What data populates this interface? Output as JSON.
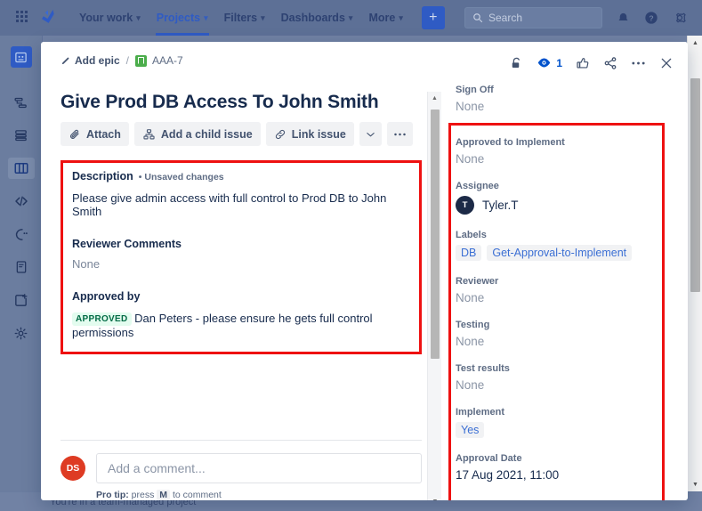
{
  "topnav": {
    "apps_icon": "app-switcher-icon",
    "logo_icon": "jira-logo-icon",
    "items": [
      {
        "label": "Your work",
        "has_chevron": true,
        "active": false
      },
      {
        "label": "Projects",
        "has_chevron": true,
        "active": true
      },
      {
        "label": "Filters",
        "has_chevron": true,
        "active": false
      },
      {
        "label": "Dashboards",
        "has_chevron": true,
        "active": false
      },
      {
        "label": "More",
        "has_chevron": true,
        "active": false
      }
    ],
    "create_label": "+",
    "search_placeholder": "Search",
    "search_value": "",
    "icons": [
      "notifications-icon",
      "help-icon",
      "settings-icon"
    ]
  },
  "leftrail": {
    "items": [
      {
        "name": "project-avatar"
      },
      {
        "name": "roadmap-icon"
      },
      {
        "name": "backlog-icon"
      },
      {
        "name": "board-icon",
        "selected": true
      },
      {
        "name": "code-icon"
      },
      {
        "name": "releases-icon"
      },
      {
        "name": "pages-icon"
      },
      {
        "name": "add-item-icon"
      },
      {
        "name": "project-settings-icon"
      }
    ]
  },
  "statusbar": {
    "text": "You're in a team-managed project"
  },
  "modal": {
    "breadcrumb": {
      "epic_label": "Add epic",
      "separator": "/",
      "issue_key": "AAA-7"
    },
    "header_actions": {
      "lock_icon": "unlock-icon",
      "watch_icon": "watch-eye-icon",
      "watch_count": "1",
      "like_icon": "thumbs-up-icon",
      "share_icon": "share-icon",
      "more_icon": "more-actions-icon",
      "close_icon": "close-icon"
    },
    "title": "Give Prod DB Access To John Smith",
    "toolbar": [
      {
        "label": "Attach",
        "icon": "attach-icon"
      },
      {
        "label": "Add a child issue",
        "icon": "child-issue-icon"
      },
      {
        "label": "Link issue",
        "icon": "link-icon"
      },
      {
        "label": "",
        "icon": "chevron-down-icon"
      },
      {
        "label": "",
        "icon": "more-actions-icon"
      }
    ],
    "description": {
      "heading": "Description",
      "unsaved": "• Unsaved changes",
      "body": "Please give admin access with full control to Prod DB to John Smith"
    },
    "reviewer_comments": {
      "heading": "Reviewer Comments",
      "value": "None"
    },
    "approved_by": {
      "heading": "Approved by",
      "badge": "APPROVED",
      "text": "Dan Peters - please ensure he gets full control permissions"
    },
    "comment": {
      "avatar_initials": "DS",
      "placeholder": "Add a comment...",
      "value": "",
      "protip_prefix": "Pro tip:",
      "protip_mid": "press",
      "protip_key": "M",
      "protip_suffix": "to comment"
    },
    "sidebar_fields": [
      {
        "label": "Sign Off",
        "value": "None",
        "kind": "none"
      },
      {
        "label": "Approved to Implement",
        "value": "None",
        "kind": "none"
      },
      {
        "label": "Assignee",
        "value": "Tyler.T",
        "kind": "user",
        "avatar_initials": "T"
      },
      {
        "label": "Labels",
        "kind": "labels",
        "values": [
          "DB",
          "Get-Approval-to-Implement"
        ]
      },
      {
        "label": "Reviewer",
        "value": "None",
        "kind": "none"
      },
      {
        "label": "Testing",
        "value": "None",
        "kind": "none"
      },
      {
        "label": "Test results",
        "value": "None",
        "kind": "none"
      },
      {
        "label": "Implement",
        "value": "Yes",
        "kind": "chip"
      },
      {
        "label": "Approval Date",
        "value": "17 Aug 2021, 11:00",
        "kind": "text"
      }
    ]
  },
  "annotations": {
    "color": "#ee1111",
    "boxes": [
      "description-region",
      "sidebar-fields-region"
    ]
  },
  "colors": {
    "brand_blue": "#0052cc",
    "link_blue": "#3b6fd4",
    "text_dark": "#172b4d",
    "text_muted": "#5e6c84",
    "approved_bg": "#e3fcef",
    "approved_text": "#036b45",
    "avatar_red": "#de3b23",
    "avatar_navy": "#1c2a47",
    "annotation_red": "#ee1111"
  }
}
